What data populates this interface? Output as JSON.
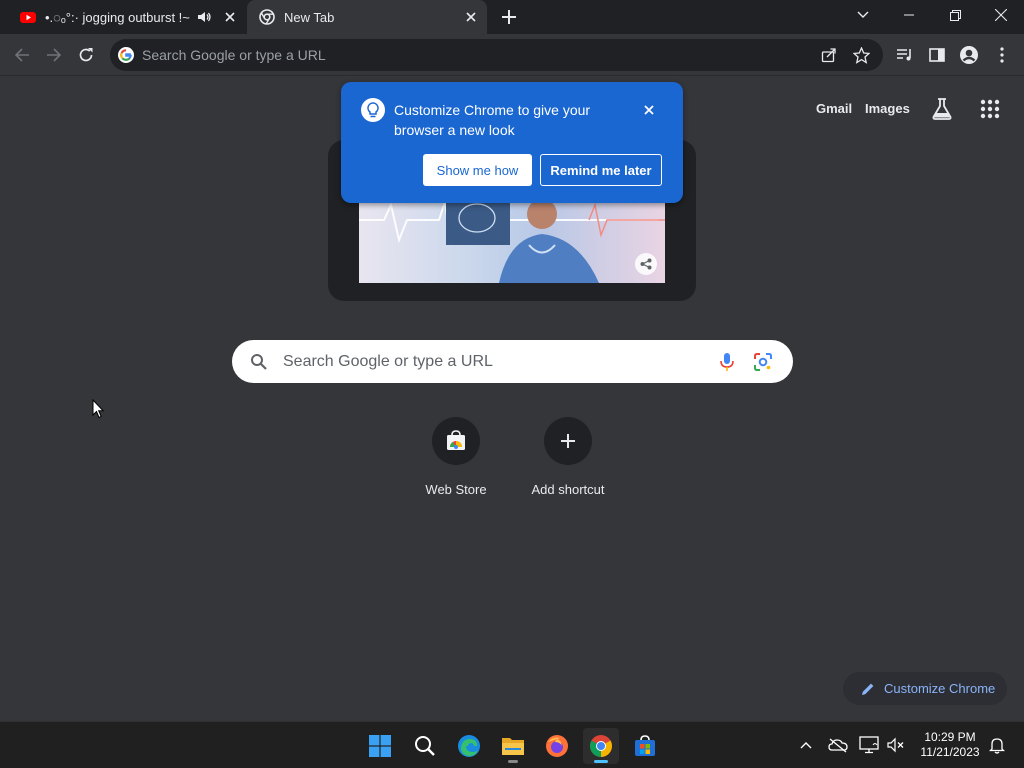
{
  "tabs": [
    {
      "title": "•.◌ₒ°:· jogging outburst !~",
      "favicon": "youtube-icon",
      "audio": "speaker-icon"
    },
    {
      "title": "New Tab",
      "favicon": "chrome-icon"
    }
  ],
  "toolbar": {
    "omnibox_placeholder": "Search Google or type a URL"
  },
  "ntp": {
    "links": {
      "gmail": "Gmail",
      "images": "Images"
    },
    "search_placeholder": "Search Google or type a URL",
    "shortcuts": [
      {
        "label": "Web Store",
        "icon": "webstore-icon"
      },
      {
        "label": "Add shortcut",
        "icon": "plus-icon"
      }
    ],
    "customize_label": "Customize Chrome"
  },
  "bubble": {
    "title": "Customize Chrome to give your browser a new look",
    "primary": "Show me how",
    "secondary": "Remind me later"
  },
  "taskbar": {
    "time": "10:29 PM",
    "date": "11/21/2023",
    "apps": [
      "start-icon",
      "search-icon",
      "edge-icon",
      "file-explorer-icon",
      "firefox-icon",
      "chrome-icon",
      "store-icon"
    ]
  },
  "colors": {
    "accent": "#1a67d2",
    "page_bg": "#35363a",
    "strip_bg": "#202124",
    "link": "#8ab4f8"
  }
}
